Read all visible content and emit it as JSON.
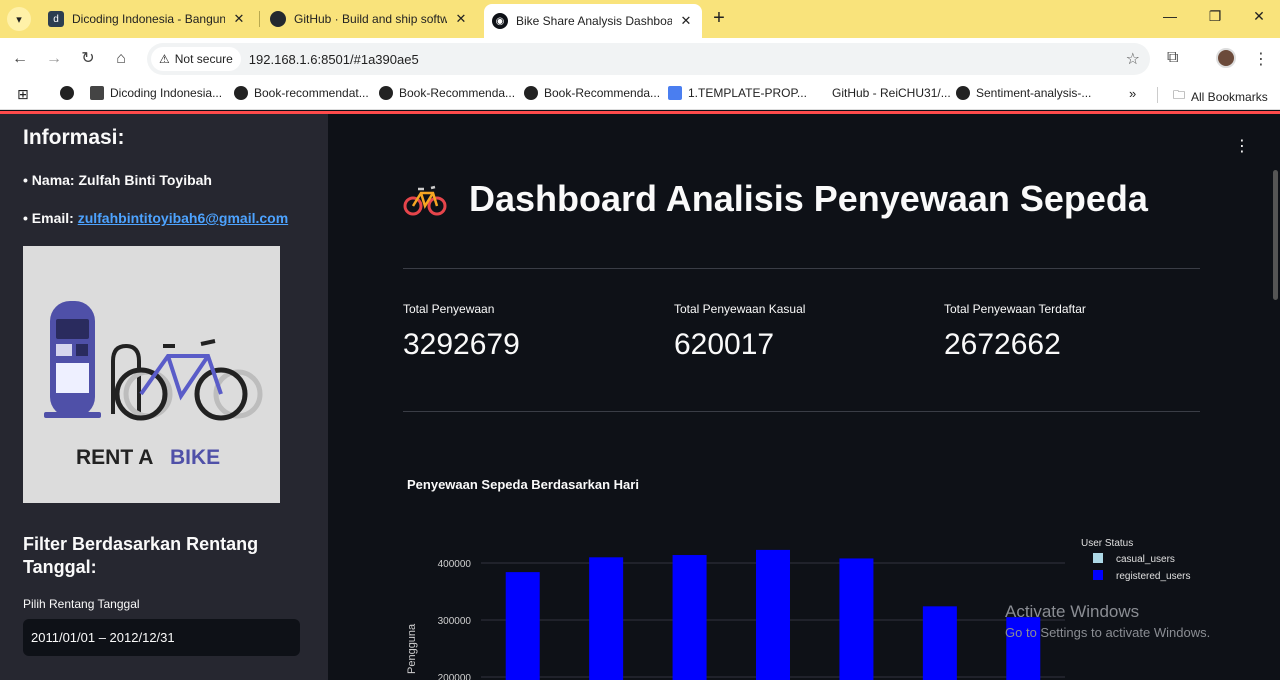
{
  "browser": {
    "tabs": [
      {
        "title": "Dicoding Indonesia - Bangun K",
        "active": false
      },
      {
        "title": "GitHub · Build and ship softwar",
        "active": false
      },
      {
        "title": "Bike Share Analysis Dashboard",
        "active": true
      }
    ],
    "security_label": "Not secure",
    "url": "192.168.1.6:8501/#1a390ae5",
    "bookmarks": [
      "Dicoding Indonesia...",
      "Book-recommendat...",
      "Book-Recommenda...",
      "Book-Recommenda...",
      "1.TEMPLATE-PROP...",
      "GitHub - ReiCHU31/...",
      "Sentiment-analysis-..."
    ],
    "all_bookmarks": "All Bookmarks"
  },
  "sidebar": {
    "heading": "Informasi:",
    "name_line": "• Nama: Zulfah Binti Toyibah",
    "email_prefix": "• Email: ",
    "email": "zulfahbintitoyibah6@gmail.com",
    "image_caption_1": "RENT A ",
    "image_caption_2": "BIKE",
    "filter_heading": "Filter Berdasarkan Rentang Tanggal:",
    "date_label": "Pilih Rentang Tanggal",
    "date_value": "2011/01/01 – 2012/12/31"
  },
  "main": {
    "title": "Dashboard Analisis Penyewaan Sepeda",
    "metrics": [
      {
        "label": "Total Penyewaan",
        "value": "3292679"
      },
      {
        "label": "Total Penyewaan Kasual",
        "value": "620017"
      },
      {
        "label": "Total Penyewaan Terdaftar",
        "value": "2672662"
      }
    ],
    "watermark_title": "Activate Windows",
    "watermark_sub": "Go to Settings to activate Windows."
  },
  "chart_data": {
    "type": "bar",
    "title": "Penyewaan Sepeda Berdasarkan Hari",
    "ylabel": "Pengguna",
    "yticks": [
      "400000",
      "300000",
      "200000"
    ],
    "legend_title": "User Status",
    "legend_position": "right",
    "series": [
      {
        "name": "casual_users",
        "color": "#add8e6",
        "values": []
      },
      {
        "name": "registered_users",
        "color": "#0000ff",
        "values": [
          384000,
          410000,
          414000,
          423000,
          408000,
          324000,
          305000
        ]
      }
    ],
    "ylim_visible": [
      195000,
      430000
    ]
  },
  "colors": {
    "accent_red": "#ff4b4b",
    "bar_blue": "#0000ff",
    "link": "#4da3ff",
    "chrome_yellow": "#f9e37b"
  }
}
